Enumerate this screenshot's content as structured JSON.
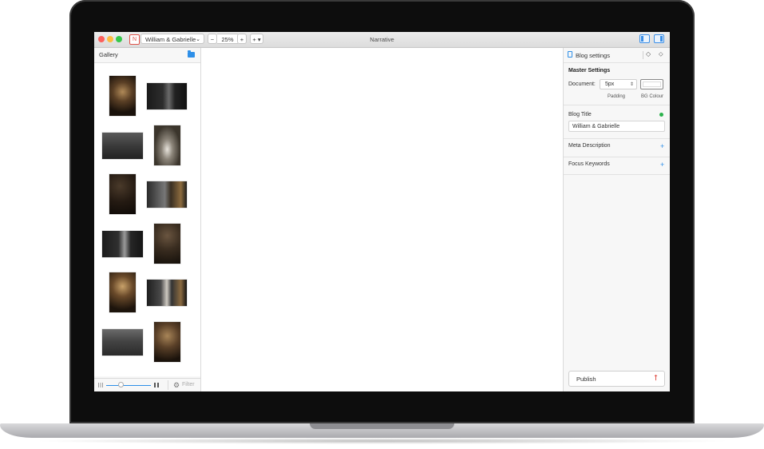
{
  "window": {
    "title": "Narrative",
    "document_name": "William & Gabrielle",
    "zoom": "25%",
    "zoom_minus": "−",
    "zoom_plus": "+",
    "add_menu": "+ ▾",
    "select_chevron": "⌄",
    "app_icon_glyph": "N"
  },
  "gallery": {
    "title": "Gallery",
    "filter_label": "Filter",
    "thumbnail_count": 12
  },
  "right_panel": {
    "title": "Blog settings",
    "master_settings": "Master Settings",
    "document_label": "Document:",
    "padding_value": "5px",
    "padding_label": "Padding",
    "bg_colour_label": "BG Colour",
    "blog_title_label": "Blog Title",
    "blog_title_value": "William & Gabrielle",
    "meta_description_label": "Meta Description",
    "focus_keywords_label": "Focus Keywords",
    "publish_label": "Publish",
    "plus": "+",
    "gem_glyph": "◇",
    "tag_glyph": "⬦",
    "stepper_glyph": "⇕",
    "upload_glyph": "⭡"
  },
  "colors": {
    "accent": "#2e8fe8",
    "status_ok": "#2bb24c",
    "brand": "#e0534a"
  }
}
